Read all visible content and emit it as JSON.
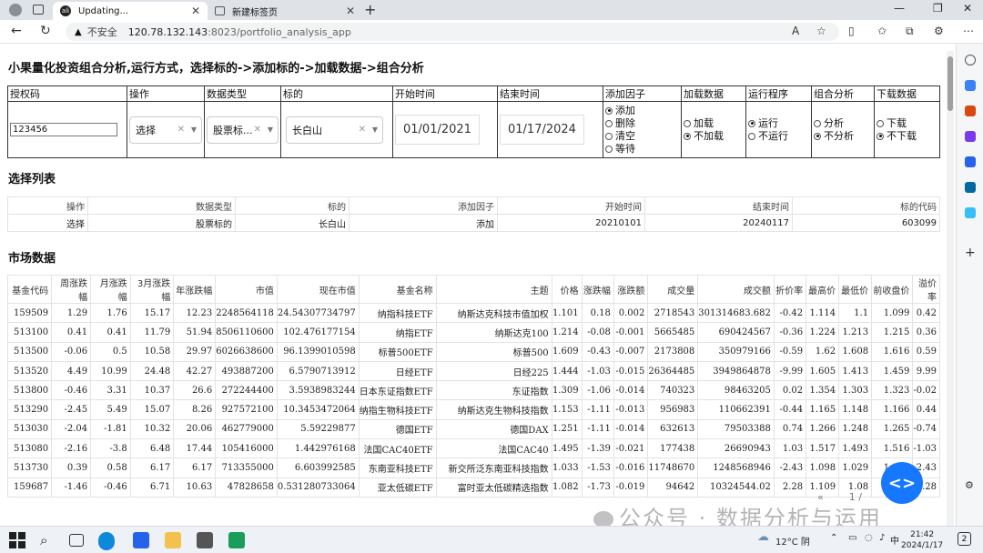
{
  "browser": {
    "tabs": [
      {
        "label": "Updating...",
        "favicon": "app-favicon"
      },
      {
        "label": "新建标签页",
        "favicon": "newtab-favicon"
      }
    ],
    "address": {
      "security_label": "不安全",
      "host": "120.78.132.143",
      "path": ":8023/portfolio_analysis_app"
    }
  },
  "page": {
    "title": "小果量化投资组合分析,运行方式，选择标的->添加标的->加载数据->组合分析",
    "controls": {
      "headers": [
        "授权码",
        "操作",
        "数据类型",
        "标的",
        "开始时间",
        "结束时间",
        "添加因子",
        "加载数据",
        "运行程序",
        "组合分析",
        "下载数据"
      ],
      "auth_code": "123456",
      "operation": "选择",
      "data_type": "股票标...",
      "target": "长白山",
      "start_date": "01/01/2021",
      "end_date": "01/17/2024",
      "factor_options": [
        "添加",
        "删除",
        "清空",
        "等待"
      ],
      "load_options": [
        "加载",
        "不加载"
      ],
      "run_options": [
        "运行",
        "不运行"
      ],
      "analysis_options": [
        "分析",
        "不分析"
      ],
      "download_options": [
        "下载",
        "不下载"
      ]
    },
    "selection_title": "选择列表",
    "selection": {
      "headers": [
        "操作",
        "数据类型",
        "标的",
        "添加因子",
        "开始时间",
        "结束时间",
        "标的代码"
      ],
      "row": [
        "选择",
        "股票标的",
        "长白山",
        "添加",
        "20210101",
        "20240117",
        "603099"
      ]
    },
    "market_title": "市场数据",
    "market": {
      "headers": [
        "基金代码",
        "周涨跌幅",
        "月涨跌幅",
        "3月涨跌幅",
        "年涨跌幅",
        "市值",
        "现在市值",
        "基金名称",
        "主题",
        "价格",
        "涨跌幅",
        "涨跌额",
        "成交量",
        "成交额",
        "折价率",
        "最高价",
        "最低价",
        "前收盘价",
        "溢价率"
      ],
      "rows": [
        [
          "159509",
          "1.29",
          "1.76",
          "15.17",
          "12.23",
          "2248564118",
          "24.54307734797",
          "纳指科技ETF",
          "纳斯达克科技市值加权",
          "1.101",
          "0.18",
          "0.002",
          "2718543",
          "301314683.682",
          "-0.42",
          "1.114",
          "1.1",
          "1.099",
          "0.42"
        ],
        [
          "513100",
          "0.41",
          "0.41",
          "11.79",
          "51.94",
          "8506110600",
          "102.476177154",
          "纳指ETF",
          "纳斯达克100",
          "1.214",
          "-0.08",
          "-0.001",
          "5665485",
          "690424567",
          "-0.36",
          "1.224",
          "1.213",
          "1.215",
          "0.36"
        ],
        [
          "513500",
          "-0.06",
          "0.5",
          "10.58",
          "29.97",
          "6026638600",
          "96.1399010598",
          "标普500ETF",
          "标普500",
          "1.609",
          "-0.43",
          "-0.007",
          "2173808",
          "350979166",
          "-0.59",
          "1.62",
          "1.608",
          "1.616",
          "0.59"
        ],
        [
          "513520",
          "4.49",
          "10.99",
          "24.48",
          "42.27",
          "493887200",
          "6.5790713912",
          "日经ETF",
          "日经225",
          "1.444",
          "-1.03",
          "-0.015",
          "26364485",
          "3949864878",
          "-9.99",
          "1.605",
          "1.413",
          "1.459",
          "9.99"
        ],
        [
          "513800",
          "-0.46",
          "3.31",
          "10.37",
          "26.6",
          "272244400",
          "3.5938983244",
          "日本东证指数ETF",
          "东证指数",
          "1.309",
          "-1.06",
          "-0.014",
          "740323",
          "98463205",
          "0.02",
          "1.354",
          "1.303",
          "1.323",
          "-0.02"
        ],
        [
          "513290",
          "-2.45",
          "5.49",
          "15.07",
          "8.26",
          "927572100",
          "10.3453472064",
          "纳指生物科技ETF",
          "纳斯达克生物科技指数",
          "1.153",
          "-1.11",
          "-0.013",
          "956983",
          "110662391",
          "-0.44",
          "1.165",
          "1.148",
          "1.166",
          "0.44"
        ],
        [
          "513030",
          "-2.04",
          "-1.81",
          "10.32",
          "20.06",
          "462779000",
          "5.59229877",
          "德国ETF",
          "德国DAX",
          "1.251",
          "-1.11",
          "-0.014",
          "632613",
          "79503388",
          "0.74",
          "1.266",
          "1.248",
          "1.265",
          "-0.74"
        ],
        [
          "513080",
          "-2.16",
          "-3.8",
          "6.48",
          "17.44",
          "105416000",
          "1.442976168",
          "法国CAC40ETF",
          "法国CAC40",
          "1.495",
          "-1.39",
          "-0.021",
          "177438",
          "26690943",
          "1.03",
          "1.517",
          "1.493",
          "1.516",
          "-1.03"
        ],
        [
          "513730",
          "0.39",
          "0.58",
          "6.17",
          "6.17",
          "713355000",
          "6.603992585",
          "东南亚科技ETF",
          "新交所泛东南亚科技指数",
          "1.033",
          "-1.53",
          "-0.016",
          "11748670",
          "1248568946",
          "-2.43",
          "1.098",
          "1.029",
          "1.049",
          "2.43"
        ],
        [
          "159687",
          "-1.46",
          "-0.46",
          "6.71",
          "10.63",
          "47828658",
          "0.531280733064",
          "亚太低碳ETF",
          "富时亚太低碳精选指数",
          "1.082",
          "-1.73",
          "-0.019",
          "94642",
          "10324544.02",
          "2.28",
          "1.109",
          "1.08",
          "1.1",
          "2.28"
        ]
      ]
    },
    "pager": {
      "prev": "«",
      "page": "1",
      "sep": "/",
      "next": "»"
    },
    "watermark": "公众号 · 数据分析与运用"
  },
  "taskbar": {
    "weather": "12°C 阴",
    "lang": "中",
    "time": "21:42",
    "date": "2024/1/17",
    "notifications": "2"
  }
}
